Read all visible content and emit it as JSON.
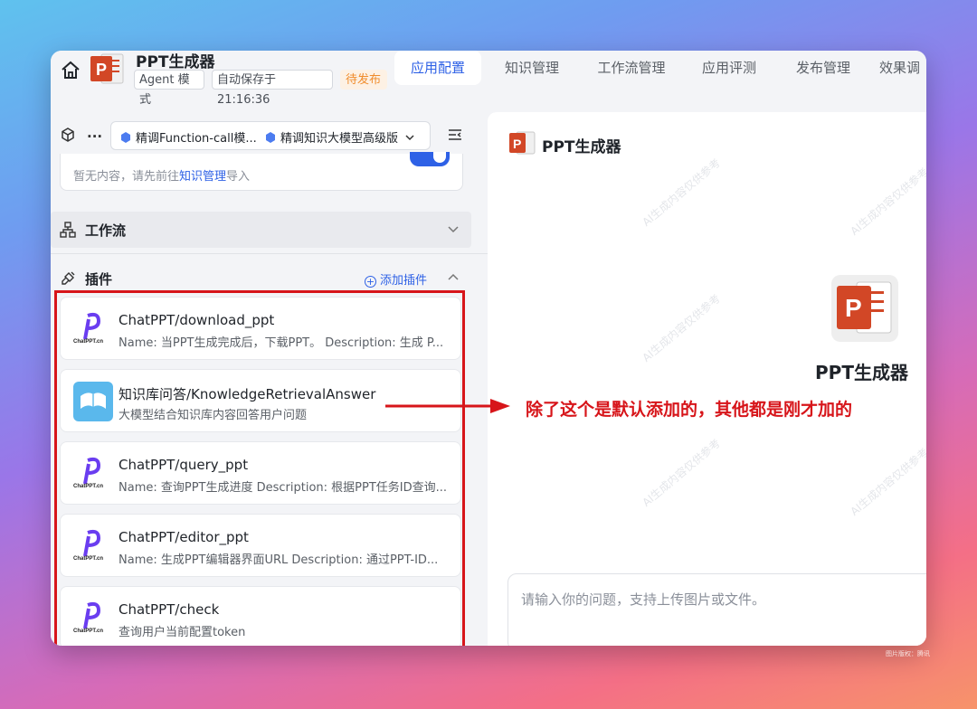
{
  "header": {
    "app_name": "PPT生成器",
    "mode_tag": "Agent 模式",
    "autosave_tag": "自动保存于 21:16:36",
    "status_tag": "待发布",
    "tabs": [
      {
        "label": "应用配置",
        "active": true
      },
      {
        "label": "知识管理",
        "active": false
      },
      {
        "label": "工作流管理",
        "active": false
      },
      {
        "label": "应用评测",
        "active": false
      },
      {
        "label": "发布管理",
        "active": false
      },
      {
        "label": "效果调",
        "active": false
      }
    ]
  },
  "left": {
    "ellipsis": "...",
    "model_1": "精调Function-call模...",
    "model_2": "精调知识大模型高级版",
    "kb_empty_prefix": "暂无内容，请先前往",
    "kb_link": "知识管理",
    "kb_empty_suffix": "导入",
    "workflow_title": "工作流",
    "plugin_title": "插件",
    "add_plugin": "添加插件",
    "plugins": [
      {
        "title": "ChatPPT/download_ppt",
        "desc": "Name: 当PPT生成完成后，下载PPT。 Description: 生成 P...",
        "logo": "chatppt-logo",
        "logo_text": "ChatPPT.cn"
      },
      {
        "title": "知识库问答/KnowledgeRetrievalAnswer",
        "desc": "大模型结合知识库内容回答用户问题",
        "logo": "book-logo"
      },
      {
        "title": "ChatPPT/query_ppt",
        "desc": "Name: 查询PPT生成进度 Description: 根据PPT任务ID查询...",
        "logo": "chatppt-logo",
        "logo_text": "ChatPPT.cn"
      },
      {
        "title": "ChatPPT/editor_ppt",
        "desc": "Name: 生成PPT编辑器界面URL Description: 通过PPT-ID...",
        "logo": "chatppt-logo",
        "logo_text": "ChatPPT.cn"
      },
      {
        "title": "ChatPPT/check",
        "desc": "查询用户当前配置token",
        "logo": "chatppt-logo",
        "logo_text": "ChatPPT.cn"
      }
    ]
  },
  "right": {
    "bot_name": "PPT生成器",
    "annotation": "除了这个是默认添加的，其他都是刚才加的",
    "input_placeholder": "请输入你的问题，支持上传图片或文件。",
    "watermark": "AI生成内容仅供参考"
  },
  "footer_credit": "图片版权：腾讯",
  "colors": {
    "accent": "#2e61e6",
    "annotation_red": "#d7151a",
    "ppt_orange": "#d24726"
  }
}
